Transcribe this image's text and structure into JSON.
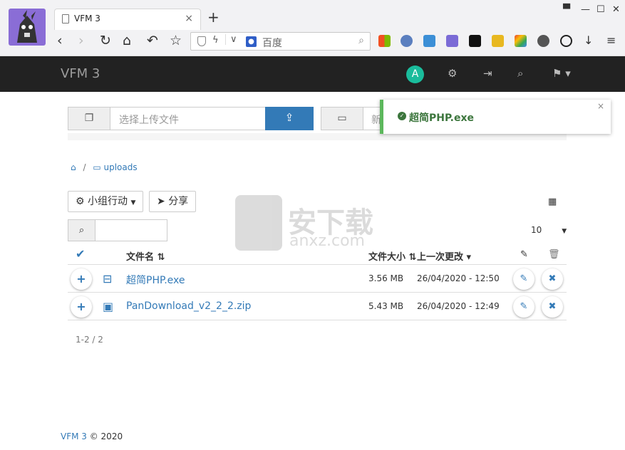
{
  "browser": {
    "tab_title": "VFM 3",
    "tab_close": "×",
    "new_tab": "+",
    "address_query": "百度",
    "window_controls": [
      "shirt-icon",
      "minimize-icon",
      "maximize-icon",
      "close-icon"
    ]
  },
  "navbar": {
    "brand": "VFM 3",
    "user_initial": "A",
    "accent": "#1abc9c",
    "bg": "#222222"
  },
  "upload": {
    "placeholder": "选择上传文件",
    "new_folder_placeholder": "新"
  },
  "toast": {
    "message": "超简PHP.exe",
    "close": "×",
    "color": "#3c763d"
  },
  "breadcrumb": {
    "separator": "/",
    "folder": "uploads"
  },
  "toolbar": {
    "group_action": "小组行动",
    "share": "分享",
    "per_page": "10"
  },
  "table": {
    "headers": {
      "name": "文件名",
      "size": "文件大小",
      "modified": "上一次更改"
    },
    "rows": [
      {
        "name": "超简PHP.exe",
        "size": "3.56 MB",
        "modified": "26/04/2020 - 12:50",
        "icon": "drive-icon"
      },
      {
        "name": "PanDownload_v2_2_2.zip",
        "size": "5.43 MB",
        "modified": "26/04/2020 - 12:49",
        "icon": "archive-icon"
      }
    ]
  },
  "pager": "1-2 / 2",
  "watermark": {
    "cn": "安下载",
    "en": "anxz.com"
  },
  "footer": {
    "brand": "VFM 3",
    "suffix": " © 2020"
  }
}
